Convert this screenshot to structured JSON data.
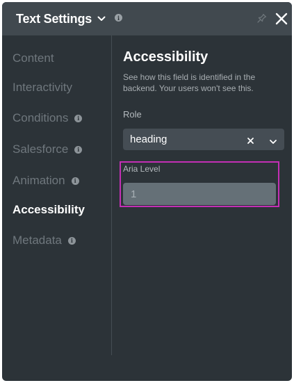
{
  "header": {
    "title": "Text Settings",
    "icons": [
      "chevron-down-icon",
      "info-icon",
      "pin-icon",
      "close-icon"
    ]
  },
  "sidebar": {
    "items": [
      {
        "label": "Content",
        "info": false,
        "active": false
      },
      {
        "label": "Interactivity",
        "info": false,
        "active": false
      },
      {
        "label": "Conditions",
        "info": true,
        "active": false
      },
      {
        "label": "Salesforce",
        "info": true,
        "active": false
      },
      {
        "label": "Animation",
        "info": true,
        "active": false
      },
      {
        "label": "Accessibility",
        "info": false,
        "active": true
      },
      {
        "label": "Metadata",
        "info": true,
        "active": false
      }
    ]
  },
  "main": {
    "section_title": "Accessibility",
    "description": "See how this field is identified in the backend. Your users won't see this.",
    "role_label": "Role",
    "role_value": "heading",
    "aria_level_label": "Aria Level",
    "aria_level_placeholder": "1"
  },
  "colors": {
    "panel_bg": "#2c3338",
    "header_bg": "#41494f",
    "highlight": "#c42fb5"
  }
}
